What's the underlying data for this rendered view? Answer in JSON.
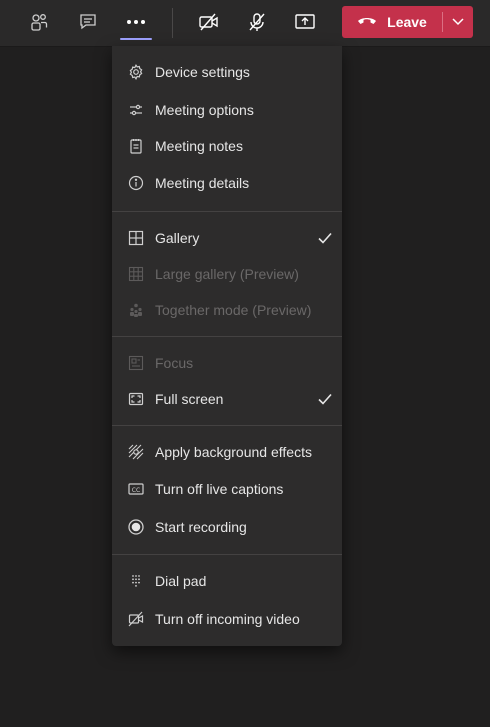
{
  "toolbar": {
    "leave_label": "Leave"
  },
  "menu": {
    "items": [
      {
        "label": "Device settings",
        "icon": "gear-icon",
        "enabled": true
      },
      {
        "label": "Meeting options",
        "icon": "sliders-icon",
        "enabled": true
      },
      {
        "label": "Meeting notes",
        "icon": "notes-icon",
        "enabled": true
      },
      {
        "label": "Meeting details",
        "icon": "info-icon",
        "enabled": true
      },
      {
        "label": "Gallery",
        "icon": "gallery-icon",
        "enabled": true,
        "checked": true
      },
      {
        "label": "Large gallery (Preview)",
        "icon": "large-gallery-icon",
        "enabled": false
      },
      {
        "label": "Together mode (Preview)",
        "icon": "together-mode-icon",
        "enabled": false
      },
      {
        "label": "Focus",
        "icon": "focus-icon",
        "enabled": false
      },
      {
        "label": "Full screen",
        "icon": "full-screen-icon",
        "enabled": true,
        "checked": true
      },
      {
        "label": "Apply background effects",
        "icon": "background-effects-icon",
        "enabled": true
      },
      {
        "label": "Turn off live captions",
        "icon": "captions-icon",
        "enabled": true
      },
      {
        "label": "Start recording",
        "icon": "record-icon",
        "enabled": true
      },
      {
        "label": "Dial pad",
        "icon": "dial-pad-icon",
        "enabled": true
      },
      {
        "label": "Turn off incoming video",
        "icon": "video-off-icon",
        "enabled": true
      }
    ]
  },
  "colors": {
    "accent": "#9ea2ff",
    "leave": "#c4314b",
    "menu_bg": "#2d2c2c",
    "app_bg": "#201f1f"
  }
}
